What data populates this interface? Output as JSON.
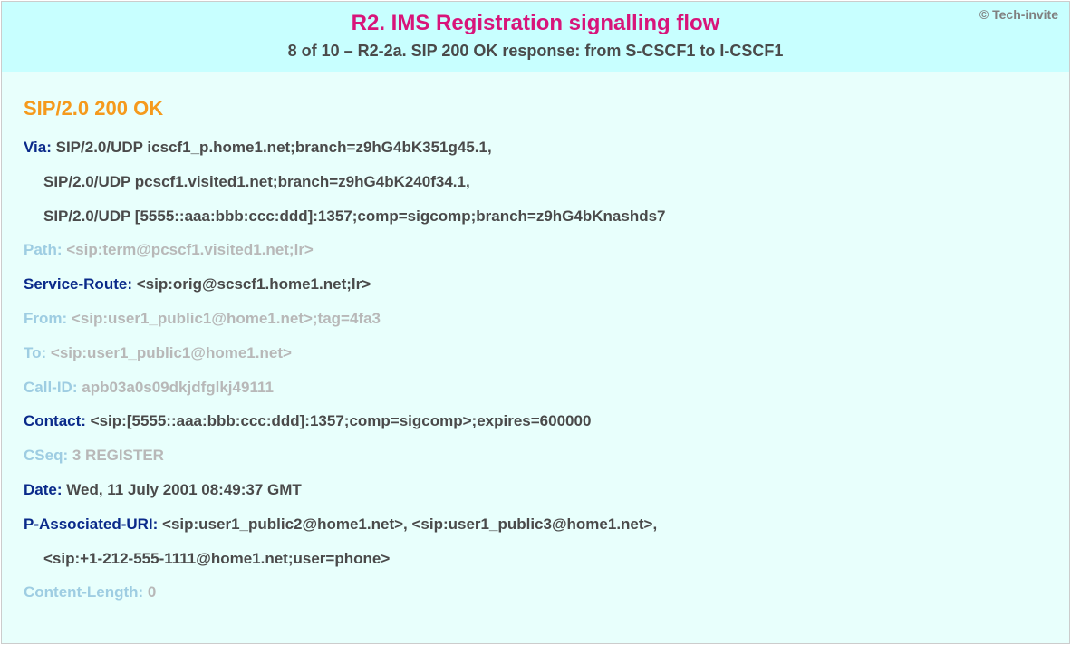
{
  "copyright": "© Tech-invite",
  "title": "R2. IMS Registration signalling flow",
  "subtitle": "8 of 10 – R2-2a. SIP 200 OK response: from S-CSCF1 to I-CSCF1",
  "status_line": "SIP/2.0 200 OK",
  "headers": {
    "via": {
      "name": "Via",
      "line1": "SIP/2.0/UDP icscf1_p.home1.net;branch=z9hG4bK351g45.1,",
      "line2": "SIP/2.0/UDP pcscf1.visited1.net;branch=z9hG4bK240f34.1,",
      "line3": "SIP/2.0/UDP [5555::aaa:bbb:ccc:ddd]:1357;comp=sigcomp;branch=z9hG4bKnashds7"
    },
    "path": {
      "name": "Path",
      "value": "<sip:term@pcscf1.visited1.net;lr>"
    },
    "service_route": {
      "name": "Service-Route",
      "value": "<sip:orig@scscf1.home1.net;lr>"
    },
    "from": {
      "name": "From",
      "value": "<sip:user1_public1@home1.net>;tag=4fa3"
    },
    "to": {
      "name": "To",
      "value": "<sip:user1_public1@home1.net>"
    },
    "call_id": {
      "name": "Call-ID",
      "value": "apb03a0s09dkjdfglkj49111"
    },
    "contact": {
      "name": "Contact",
      "value": "<sip:[5555::aaa:bbb:ccc:ddd]:1357;comp=sigcomp>;expires=600000"
    },
    "cseq": {
      "name": "CSeq",
      "value": "3 REGISTER"
    },
    "date": {
      "name": "Date",
      "value": "Wed, 11 July 2001 08:49:37 GMT"
    },
    "p_associated_uri": {
      "name": "P-Associated-URI",
      "line1": "<sip:user1_public2@home1.net>, <sip:user1_public3@home1.net>,",
      "line2": "<sip:+1-212-555-1111@home1.net;user=phone>"
    },
    "content_length": {
      "name": "Content-Length",
      "value": "0"
    }
  }
}
